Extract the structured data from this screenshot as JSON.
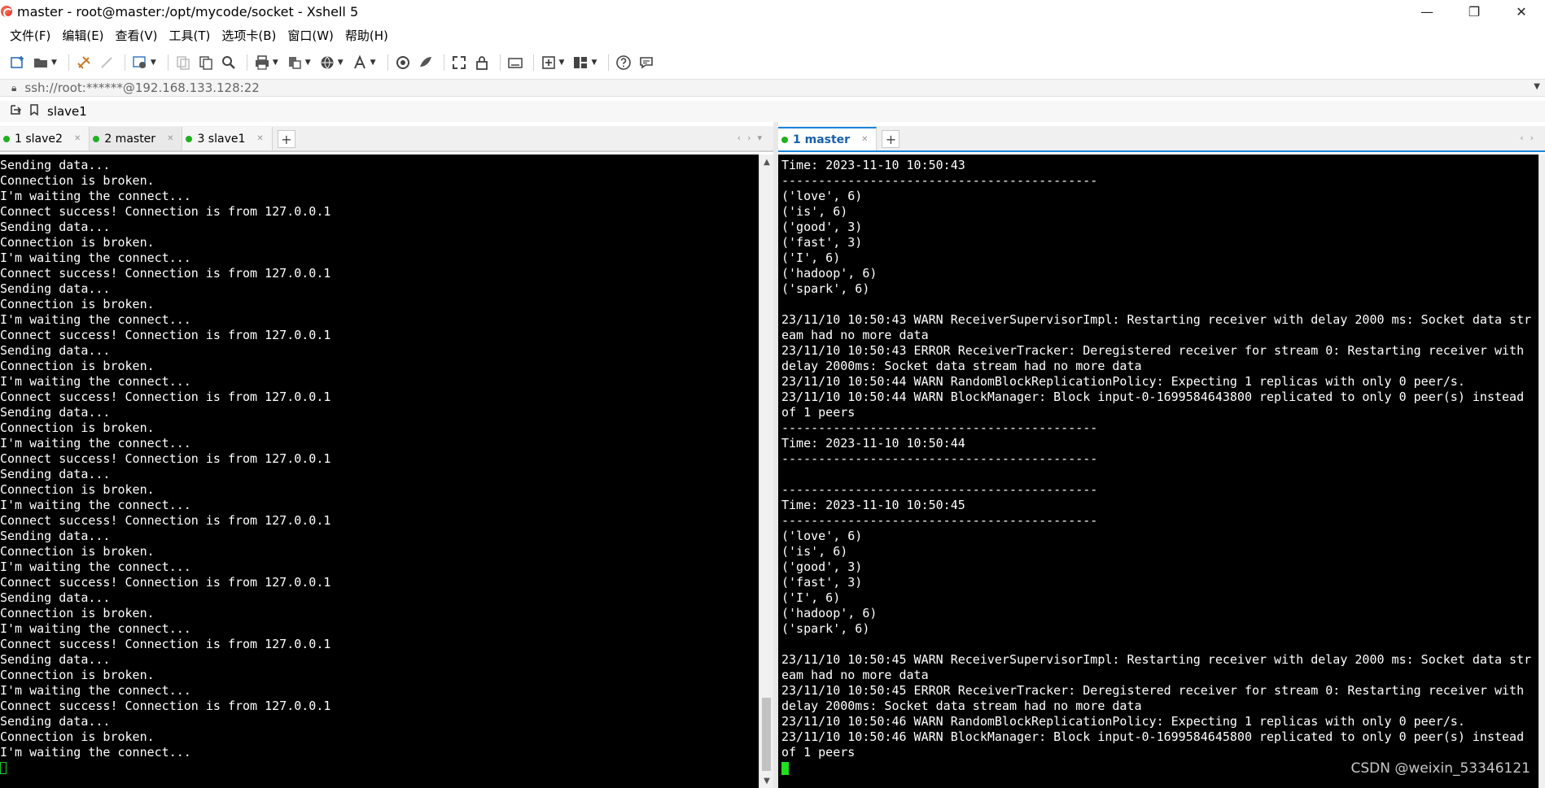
{
  "window": {
    "title": "master - root@master:/opt/mycode/socket - Xshell 5",
    "minimize_glyph": "—",
    "restore_glyph": "❐",
    "close_glyph": "✕"
  },
  "menu": [
    "文件(F)",
    "编辑(E)",
    "查看(V)",
    "工具(T)",
    "选项卡(B)",
    "窗口(W)",
    "帮助(H)"
  ],
  "address": {
    "value": "ssh://root:******@192.168.133.128:22"
  },
  "session_bar": {
    "label": "slave1"
  },
  "left_tabs": [
    {
      "number": "1",
      "name": "slave2",
      "label": "1 slave2"
    },
    {
      "number": "2",
      "name": "master",
      "label": "2 master"
    },
    {
      "number": "3",
      "name": "slave1",
      "label": "3 slave1"
    }
  ],
  "right_tabs": [
    {
      "number": "1",
      "name": "master",
      "label": "1 master"
    }
  ],
  "left_terminal": {
    "lines": [
      "Sending data...",
      "Connection is broken.",
      "I'm waiting the connect...",
      "Connect success! Connection is from 127.0.0.1",
      "Sending data...",
      "Connection is broken.",
      "I'm waiting the connect...",
      "Connect success! Connection is from 127.0.0.1",
      "Sending data...",
      "Connection is broken.",
      "I'm waiting the connect...",
      "Connect success! Connection is from 127.0.0.1",
      "Sending data...",
      "Connection is broken.",
      "I'm waiting the connect...",
      "Connect success! Connection is from 127.0.0.1",
      "Sending data...",
      "Connection is broken.",
      "I'm waiting the connect...",
      "Connect success! Connection is from 127.0.0.1",
      "Sending data...",
      "Connection is broken.",
      "I'm waiting the connect...",
      "Connect success! Connection is from 127.0.0.1",
      "Sending data...",
      "Connection is broken.",
      "I'm waiting the connect...",
      "Connect success! Connection is from 127.0.0.1",
      "Sending data...",
      "Connection is broken.",
      "I'm waiting the connect...",
      "Connect success! Connection is from 127.0.0.1",
      "Sending data...",
      "Connection is broken.",
      "I'm waiting the connect...",
      "Connect success! Connection is from 127.0.0.1",
      "Sending data...",
      "Connection is broken.",
      "I'm waiting the connect..."
    ]
  },
  "right_terminal": {
    "lines": [
      "Time: 2023-11-10 10:50:43",
      "-------------------------------------------",
      "('love', 6)",
      "('is', 6)",
      "('good', 3)",
      "('fast', 3)",
      "('I', 6)",
      "('hadoop', 6)",
      "('spark', 6)",
      "",
      "23/11/10 10:50:43 WARN ReceiverSupervisorImpl: Restarting receiver with delay 2000 ms: Socket data str",
      "eam had no more data",
      "23/11/10 10:50:43 ERROR ReceiverTracker: Deregistered receiver for stream 0: Restarting receiver with",
      "delay 2000ms: Socket data stream had no more data",
      "23/11/10 10:50:44 WARN RandomBlockReplicationPolicy: Expecting 1 replicas with only 0 peer/s.",
      "23/11/10 10:50:44 WARN BlockManager: Block input-0-1699584643800 replicated to only 0 peer(s) instead",
      "of 1 peers",
      "-------------------------------------------",
      "Time: 2023-11-10 10:50:44",
      "-------------------------------------------",
      "",
      "-------------------------------------------",
      "Time: 2023-11-10 10:50:45",
      "-------------------------------------------",
      "('love', 6)",
      "('is', 6)",
      "('good', 3)",
      "('fast', 3)",
      "('I', 6)",
      "('hadoop', 6)",
      "('spark', 6)",
      "",
      "23/11/10 10:50:45 WARN ReceiverSupervisorImpl: Restarting receiver with delay 2000 ms: Socket data str",
      "eam had no more data",
      "23/11/10 10:50:45 ERROR ReceiverTracker: Deregistered receiver for stream 0: Restarting receiver with",
      "delay 2000ms: Socket data stream had no more data",
      "23/11/10 10:50:46 WARN RandomBlockReplicationPolicy: Expecting 1 replicas with only 0 peer/s.",
      "23/11/10 10:50:46 WARN BlockManager: Block input-0-1699584645800 replicated to only 0 peer(s) instead",
      "of 1 peers"
    ]
  },
  "watermark": "CSDN @weixin_53346121",
  "colors": {
    "terminal_bg": "#000000",
    "terminal_fg": "#ffffff",
    "cursor": "#20e020",
    "active_tab_accent": "#1a86d9",
    "session_dot": "#20b020"
  }
}
